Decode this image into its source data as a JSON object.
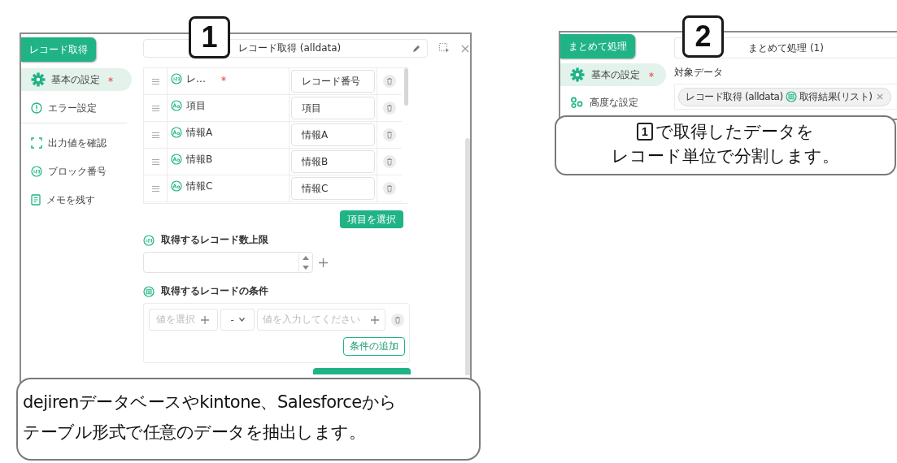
{
  "panel_1": {
    "tab": "レコード取得",
    "title": "レコード取得 (alldata)",
    "sidebar_groups": [
      [
        {
          "kind": "gear",
          "label": "基本の設定",
          "required": true,
          "selected": true
        },
        {
          "kind": "alert",
          "label": "エラー設定",
          "required": false,
          "selected": false
        }
      ],
      [
        {
          "kind": "frame",
          "label": "出力値を確認",
          "required": false,
          "selected": false
        },
        {
          "kind": "number",
          "label": "ブロック番号",
          "required": false,
          "selected": false
        },
        {
          "kind": "memo",
          "label": "メモを残す",
          "required": false,
          "selected": false
        }
      ]
    ],
    "rows": [
      {
        "kind": "number",
        "name": "レ…",
        "required": true,
        "value": "レコード番号"
      },
      {
        "kind": "text",
        "name": "項目",
        "required": false,
        "value": "項目"
      },
      {
        "kind": "text",
        "name": "情報A",
        "required": false,
        "value": "情報A"
      },
      {
        "kind": "text",
        "name": "情報B",
        "required": false,
        "value": "情報B"
      },
      {
        "kind": "text",
        "name": "情報C",
        "required": false,
        "value": "情報C"
      }
    ],
    "select_button": "項目を選択",
    "limit_section": {
      "title": "取得するレコード数上限"
    },
    "condition_section": {
      "title": "取得するレコードの条件",
      "value_select": {
        "placeholder": "値を選択"
      },
      "operator": "-",
      "value_input": {
        "placeholder": "値を入力してください"
      },
      "add_button": "条件の追加"
    }
  },
  "badge_1": "1",
  "callout_1": {
    "lines": [
      "dejirenデータベースやkintone、Salesforceから",
      "テーブル形式で任意のデータを抽出します。"
    ]
  },
  "panel_2": {
    "tab": "まとめて処理",
    "title": "まとめて処理 (1)",
    "sidebar": [
      {
        "kind": "gear",
        "label": "基本の設定",
        "required": true,
        "selected": true
      },
      {
        "kind": "gears",
        "label": "高度な設定",
        "required": false,
        "selected": false
      }
    ],
    "target_label": "対象データ",
    "chip": {
      "source": "レコード取得 (alldata)",
      "result": "取得結果(リスト)"
    }
  },
  "badge_2": "2",
  "callout_2": {
    "ref_badge": "1",
    "lines": [
      "で取得したデータを",
      "レコード単位で分割します。"
    ]
  }
}
